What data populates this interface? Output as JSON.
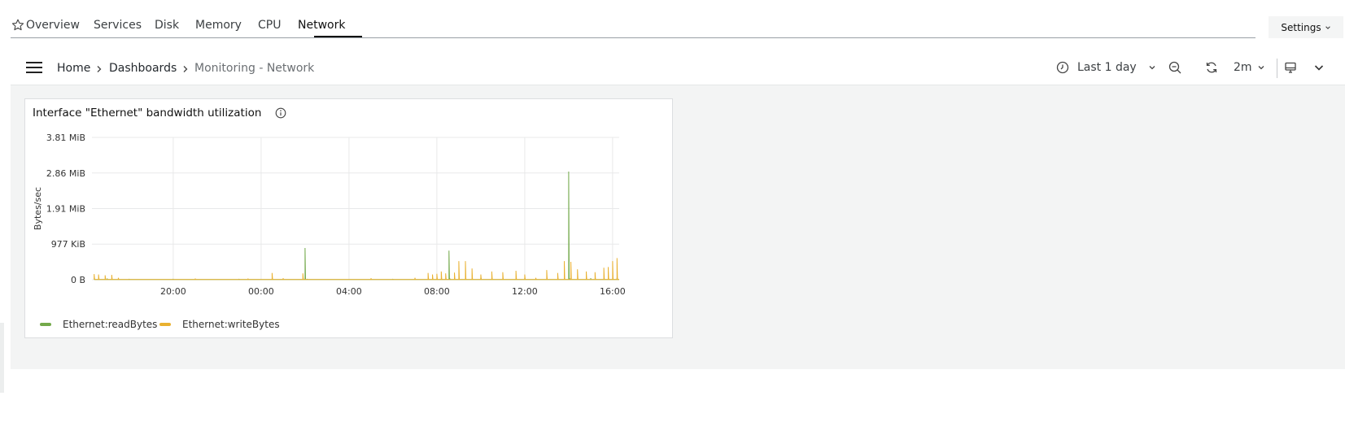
{
  "tabs": [
    {
      "label": "Overview"
    },
    {
      "label": "Services"
    },
    {
      "label": "Disk"
    },
    {
      "label": "Memory"
    },
    {
      "label": "CPU"
    },
    {
      "label": "Network"
    }
  ],
  "active_tab": "Network",
  "settings_label": "Settings",
  "breadcrumb": [
    "Home",
    "Dashboards",
    "Monitoring - Network"
  ],
  "toolbar": {
    "time_range": "Last 1 day",
    "refresh_interval": "2m"
  },
  "colors": {
    "read": "#73a94a",
    "write": "#e9b130",
    "grid": "#e8e9ea"
  },
  "panel": {
    "title": "Interface \"Ethernet\" bandwidth utilization"
  },
  "chart_data": {
    "type": "line",
    "ylabel": "Bytes/sec",
    "y_ticks": [
      "0 B",
      "977 KiB",
      "1.91 MiB",
      "2.86 MiB",
      "3.81 MiB"
    ],
    "y_tick_values_mib": [
      0,
      0.954,
      1.907,
      2.861,
      3.815
    ],
    "ylim_mib": [
      0,
      3.815
    ],
    "x_ticks": [
      "20:00",
      "00:00",
      "04:00",
      "08:00",
      "12:00",
      "16:00"
    ],
    "x_tick_hours": [
      20,
      24,
      28,
      32,
      36,
      40
    ],
    "xlim_hours": [
      16.3,
      40.3
    ],
    "grid": true,
    "legend_position": "bottom-left",
    "series": [
      {
        "name": "Ethernet:readBytes",
        "color": "#73a94a",
        "points": [
          [
            16.4,
            0.01
          ],
          [
            17.0,
            0.02
          ],
          [
            18.0,
            0.01
          ],
          [
            20.0,
            0.01
          ],
          [
            23.0,
            0.01
          ],
          [
            26.0,
            0.85
          ],
          [
            26.1,
            0.01
          ],
          [
            30.0,
            0.01
          ],
          [
            32.0,
            0.03
          ],
          [
            32.55,
            0.78
          ],
          [
            32.6,
            0.02
          ],
          [
            34.0,
            0.05
          ],
          [
            36.0,
            0.02
          ],
          [
            38.0,
            2.9
          ],
          [
            38.05,
            0.03
          ],
          [
            39.0,
            0.04
          ],
          [
            40.2,
            0.05
          ]
        ]
      },
      {
        "name": "Ethernet:writeBytes",
        "color": "#e9b130",
        "points": [
          [
            16.4,
            0.15
          ],
          [
            16.6,
            0.14
          ],
          [
            16.9,
            0.12
          ],
          [
            17.2,
            0.13
          ],
          [
            17.5,
            0.05
          ],
          [
            21.0,
            0.03
          ],
          [
            23.4,
            0.03
          ],
          [
            24.5,
            0.18
          ],
          [
            25.0,
            0.04
          ],
          [
            25.9,
            0.17
          ],
          [
            29.0,
            0.04
          ],
          [
            31.0,
            0.05
          ],
          [
            31.6,
            0.18
          ],
          [
            31.8,
            0.14
          ],
          [
            32.0,
            0.16
          ],
          [
            32.2,
            0.22
          ],
          [
            32.4,
            0.17
          ],
          [
            32.8,
            0.19
          ],
          [
            33.0,
            0.5
          ],
          [
            33.3,
            0.5
          ],
          [
            33.6,
            0.3
          ],
          [
            34.0,
            0.14
          ],
          [
            34.5,
            0.22
          ],
          [
            35.0,
            0.2
          ],
          [
            35.6,
            0.24
          ],
          [
            36.0,
            0.14
          ],
          [
            36.5,
            0.05
          ],
          [
            37.0,
            0.26
          ],
          [
            37.5,
            0.18
          ],
          [
            37.8,
            0.5
          ],
          [
            38.1,
            0.48
          ],
          [
            38.4,
            0.28
          ],
          [
            38.8,
            0.22
          ],
          [
            39.2,
            0.2
          ],
          [
            39.6,
            0.32
          ],
          [
            39.8,
            0.34
          ],
          [
            40.0,
            0.5
          ],
          [
            40.2,
            0.58
          ]
        ]
      }
    ]
  }
}
